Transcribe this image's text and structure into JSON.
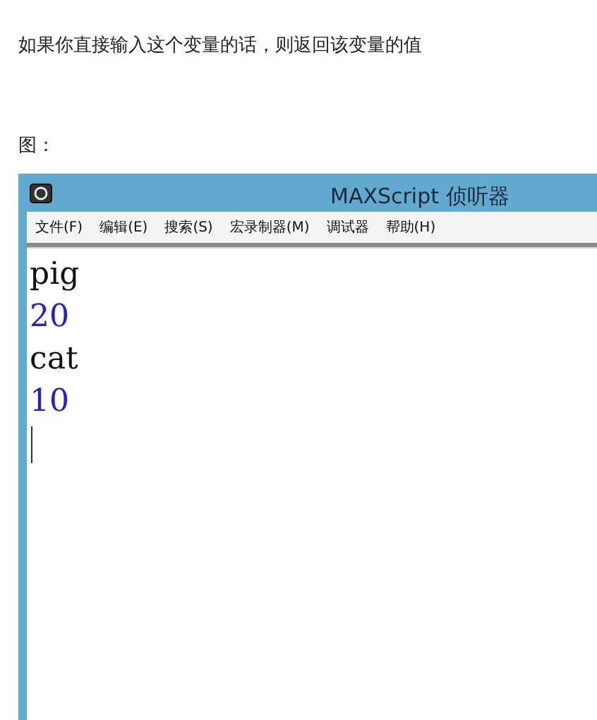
{
  "intro": "如果你直接输入这个变量的话，则返回该变量的值",
  "figure_label": "图：",
  "window": {
    "title": "MAXScript 侦听器",
    "menu": [
      "文件(F)",
      "编辑(E)",
      "搜索(S)",
      "宏录制器(M)",
      "调试器",
      "帮助(H)"
    ],
    "lines": [
      {
        "kind": "input",
        "text": "pig"
      },
      {
        "kind": "output",
        "text": "20"
      },
      {
        "kind": "input",
        "text": "cat"
      },
      {
        "kind": "output",
        "text": "10"
      }
    ]
  }
}
